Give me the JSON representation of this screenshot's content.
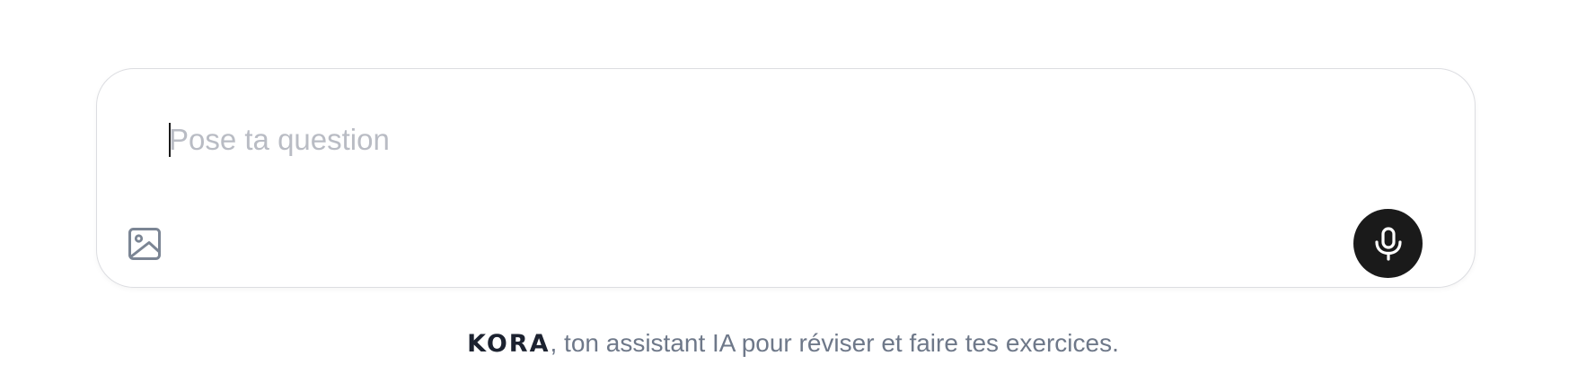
{
  "composer": {
    "placeholder": "Pose ta question",
    "value": ""
  },
  "icons": {
    "attach_image": "image-icon",
    "voice": "microphone-icon"
  },
  "footer": {
    "brand": "KORA",
    "tagline": ", ton assistant IA pour réviser et faire tes exercices."
  },
  "colors": {
    "mic_button_bg": "#1a1a1a",
    "icon_gray": "#7b8594",
    "placeholder": "#b9bcc4",
    "footer_text": "#6e7889",
    "brand_text": "#1c2230",
    "border": "#dcdde1"
  }
}
